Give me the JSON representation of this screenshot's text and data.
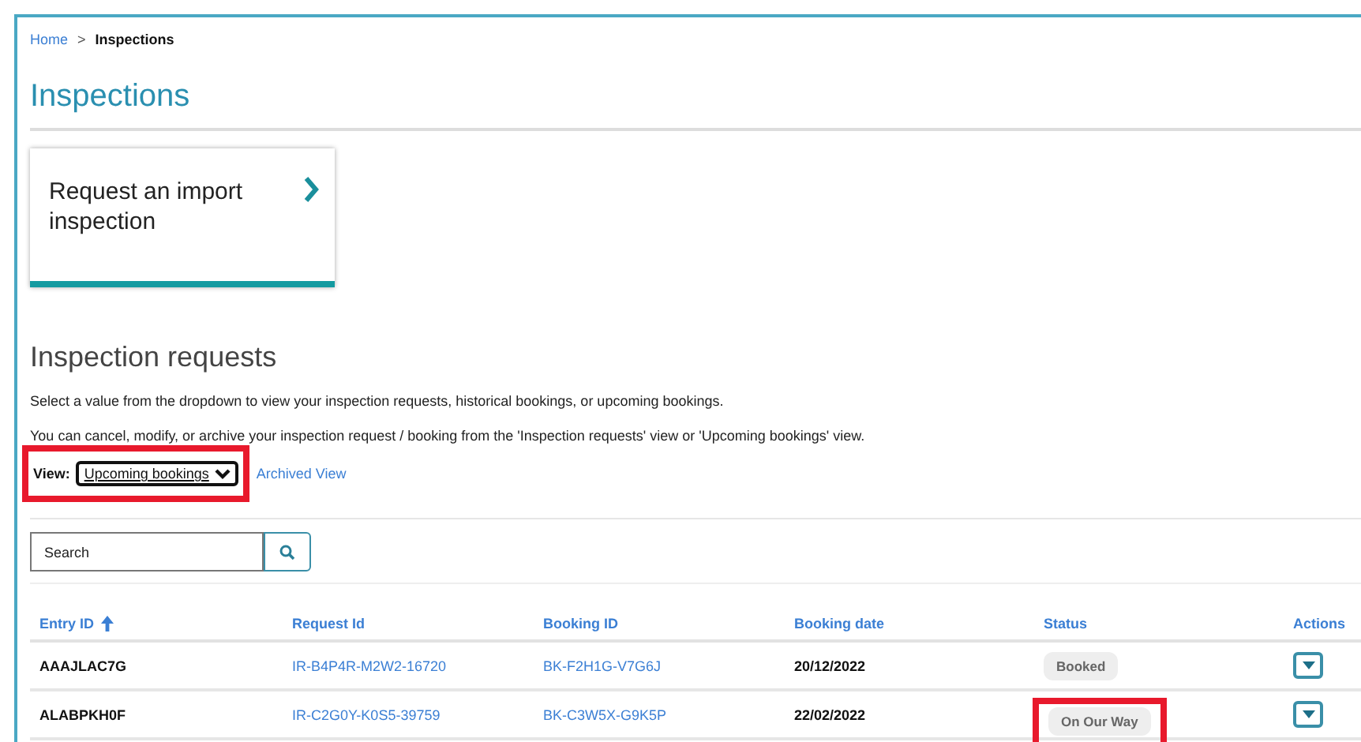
{
  "breadcrumb": [
    {
      "label": "Home",
      "kind": "link"
    },
    {
      "label": ">",
      "kind": "separator"
    },
    {
      "label": "Inspections",
      "kind": "current"
    }
  ],
  "title": "Inspections",
  "card": {
    "label": "Request an import inspection"
  },
  "section": {
    "heading": "Inspection requests",
    "lines": [
      "Select a value from the dropdown to view your inspection requests, historical bookings, or upcoming bookings.",
      "You can cancel, modify, or archive your inspection request / booking from the 'Inspection requests' view or 'Upcoming bookings' view."
    ],
    "view": {
      "label": "View:",
      "value": "Upcoming bookings",
      "highlighted": true
    },
    "archived_link": "Archived View"
  },
  "search": {
    "placeholder": "Search"
  },
  "table": {
    "columns": [
      {
        "label": "Entry ID",
        "sorted": true
      },
      {
        "label": "Request Id",
        "sorted": false
      },
      {
        "label": "Booking ID",
        "sorted": false
      },
      {
        "label": "Booking date",
        "sorted": false
      },
      {
        "label": "Status",
        "sorted": false
      },
      {
        "label": "Actions",
        "sorted": false
      }
    ],
    "rows": [
      {
        "entry_id": "AAAJLAC7G",
        "request_id": "IR-B4P4R-M2W2-16720",
        "booking_id": "BK-F2H1G-V7G6J",
        "booking_date": "20/12/2022",
        "status": "Booked",
        "highlighted": false
      },
      {
        "entry_id": "ALABPKH0F",
        "request_id": "IR-C2G0Y-K0S5-39759",
        "booking_id": "BK-C3W5X-G9K5P",
        "booking_date": "22/02/2022",
        "status": "On Our Way",
        "highlighted": true
      }
    ]
  }
}
